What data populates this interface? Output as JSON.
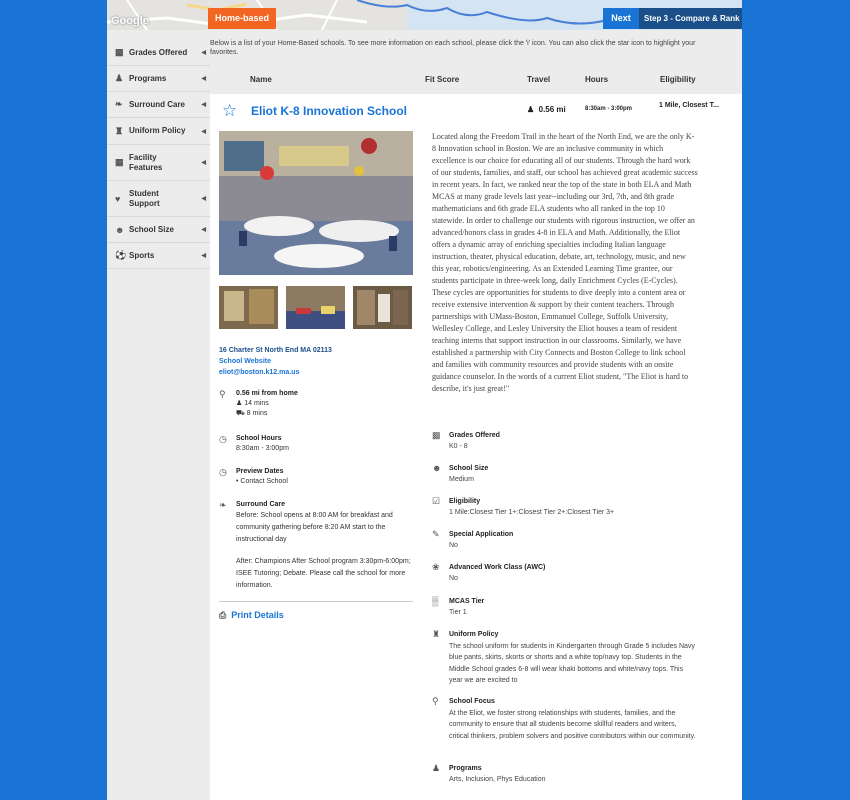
{
  "map": {
    "logo": "Google"
  },
  "header": {
    "home_tab": "Home-based",
    "next_label": "Next",
    "step_label": "Step 3 - Compare & Rank"
  },
  "sidebar": {
    "items": [
      {
        "label": "Grades Offered",
        "icon": "blocks-icon"
      },
      {
        "label": "Programs",
        "icon": "person-icon"
      },
      {
        "label": "Surround Care",
        "icon": "hands-icon"
      },
      {
        "label": "Uniform Policy",
        "icon": "shirt-icon"
      },
      {
        "label": "Facility Features",
        "icon": "building-icon"
      },
      {
        "label": "Student Support",
        "icon": "heart-icon"
      },
      {
        "label": "School Size",
        "icon": "group-icon"
      },
      {
        "label": "Sports",
        "icon": "ball-icon"
      }
    ]
  },
  "intro": "Below is a list of your Home-Based schools. To see more information on each school, please click the 'i' icon. You can also click the star icon to highlight your favorites.",
  "columns": {
    "name": "Name",
    "fit": "Fit Score",
    "travel": "Travel",
    "hours": "Hours",
    "eligibility": "Eligibility"
  },
  "school": {
    "name": "Eliot K-8 Innovation School",
    "travel": "0.56 mi",
    "hours": "8:30am - 3:00pm",
    "eligibility": "1 Mile, Closest T...",
    "address": "16 Charter St North End MA 02113",
    "website_label": "School Website",
    "email": "eliot@boston.k12.ma.us",
    "distance": "0.56 mi from home",
    "walk_time": "14 mins",
    "drive_time": "8 mins",
    "hours_title": "School Hours",
    "hours_value": "8:30am - 3:00pm",
    "preview_title": "Preview Dates",
    "preview_value": "• Contact School",
    "surround_title": "Surround Care",
    "surround_before": "Before: School opens at 8:00 AM for breakfast and community gathering before 8:20 AM start to the instructional day",
    "surround_after": "After: Champions After School program 3:30pm-6:00pm; ISEE Tutoring; Debate. Please call the school for more information.",
    "print_label": "Print Details",
    "description": "Located along the Freedom Trail in the heart of the North End, we are the only K-8 Innovation school in Boston. We are an inclusive community in which excellence is our choice for educating all of our students. Through the hard work of our students, families, and staff, our school has achieved great academic success in recent years. In fact, we ranked near the top of the state in both ELA and Math MCAS at many grade levels last year--including our 3rd, 7th, and 8th grade mathematicians and 6th grade ELA students who all ranked in the top 10 statewide. In order to challenge our students with rigorous instruction, we offer an advanced/honors class in grades 4-8 in ELA and Math. Additionally, the Eliot offers a dynamic array of enriching specialties including Italian language instruction, theater, physical education, debate, art, technology, music, and new this year, robotics/engineering. As an Extended Learning Time grantee, our students participate in three-week long, daily Enrichment Cycles (E-Cycles). These cycles are opportunities for students to dive deeply into a content area or receive extensive intervention & support by their content teachers. Through partnerships with UMass-Boston, Emmanuel College, Suffolk University, Wellesley College, and Lesley University the Eliot houses a team of resident teaching interns that support instruction in our classrooms. Similarly, we have established a partnership with City Connects and Boston College to link school and families with community resources and provide students with an onsite guidance counselor. In the words of a current Eliot student, \"The Eliot is hard to describe, it's just great!\"",
    "details": [
      {
        "title": "Grades Offered",
        "value": "K0 - 8",
        "icon": "blocks-icon"
      },
      {
        "title": "School Size",
        "value": "Medium",
        "icon": "group-icon"
      },
      {
        "title": "Eligibility",
        "value": "1 Mile:Closest Tier 1+:Closest Tier 2+:Closest Tier 3+",
        "icon": "checklist-icon"
      },
      {
        "title": "Special Application",
        "value": "No",
        "icon": "document-icon"
      },
      {
        "title": "Advanced Work Class (AWC)",
        "value": "No",
        "icon": "ribbon-icon"
      },
      {
        "title": "MCAS Tier",
        "value": "Tier 1",
        "icon": "bar-chart-icon"
      },
      {
        "title": "Uniform Policy",
        "value": "The school uniform for students in Kindergarten through Grade 5 includes Navy blue pants, skirts, skorts or shorts and a white top/navy top. Students in the Middle School grades 6-8 will wear khaki bottoms and white/navy tops. This year we are excited to",
        "icon": "shirt-icon"
      },
      {
        "title": "School Focus",
        "value": "At the Eliot, we foster strong relationships with students, families, and the community to ensure that all students become skillful readers and writers, critical thinkers, problem solvers and positive contributors within our community.",
        "icon": "magnifier-icon"
      },
      {
        "title": "Programs",
        "value": "Arts, Inclusion, Phys Education",
        "icon": "person-icon"
      }
    ]
  }
}
